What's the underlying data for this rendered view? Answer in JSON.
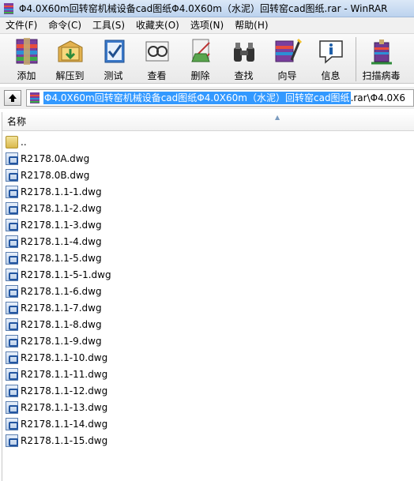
{
  "window": {
    "title": "Φ4.0X60m回转窑机械设备cad图纸Φ4.0X60m（水泥）回转窑cad图纸.rar - WinRAR"
  },
  "menu": [
    {
      "label": "文件(F)"
    },
    {
      "label": "命令(C)"
    },
    {
      "label": "工具(S)"
    },
    {
      "label": "收藏夹(O)"
    },
    {
      "label": "选项(N)"
    },
    {
      "label": "帮助(H)"
    }
  ],
  "toolbar": {
    "buttons": [
      {
        "label": "添加",
        "icon": "add-archive-icon"
      },
      {
        "label": "解压到",
        "icon": "extract-to-icon"
      },
      {
        "label": "测试",
        "icon": "test-icon"
      },
      {
        "label": "查看",
        "icon": "view-icon"
      },
      {
        "label": "删除",
        "icon": "delete-icon"
      },
      {
        "label": "查找",
        "icon": "find-icon"
      },
      {
        "label": "向导",
        "icon": "wizard-icon"
      },
      {
        "label": "信息",
        "icon": "info-icon"
      },
      {
        "label": "扫描病毒",
        "icon": "scan-virus-icon"
      }
    ]
  },
  "address": {
    "selected": "Φ4.0X60m回转窑机械设备cad图纸Φ4.0X60m（水泥）回转窑cad图纸",
    "rest": ".rar\\Φ4.0X6"
  },
  "list": {
    "column_name": "名称",
    "items": [
      {
        "name": "..",
        "type": "folder"
      },
      {
        "name": "R2178.0A.dwg",
        "type": "dwg"
      },
      {
        "name": "R2178.0B.dwg",
        "type": "dwg"
      },
      {
        "name": "R2178.1.1-1.dwg",
        "type": "dwg"
      },
      {
        "name": "R2178.1.1-2.dwg",
        "type": "dwg"
      },
      {
        "name": "R2178.1.1-3.dwg",
        "type": "dwg"
      },
      {
        "name": "R2178.1.1-4.dwg",
        "type": "dwg"
      },
      {
        "name": "R2178.1.1-5.dwg",
        "type": "dwg"
      },
      {
        "name": "R2178.1.1-5-1.dwg",
        "type": "dwg"
      },
      {
        "name": "R2178.1.1-6.dwg",
        "type": "dwg"
      },
      {
        "name": "R2178.1.1-7.dwg",
        "type": "dwg"
      },
      {
        "name": "R2178.1.1-8.dwg",
        "type": "dwg"
      },
      {
        "name": "R2178.1.1-9.dwg",
        "type": "dwg"
      },
      {
        "name": "R2178.1.1-10.dwg",
        "type": "dwg"
      },
      {
        "name": "R2178.1.1-11.dwg",
        "type": "dwg"
      },
      {
        "name": "R2178.1.1-12.dwg",
        "type": "dwg"
      },
      {
        "name": "R2178.1.1-13.dwg",
        "type": "dwg"
      },
      {
        "name": "R2178.1.1-14.dwg",
        "type": "dwg"
      },
      {
        "name": "R2178.1.1-15.dwg",
        "type": "dwg"
      }
    ]
  }
}
